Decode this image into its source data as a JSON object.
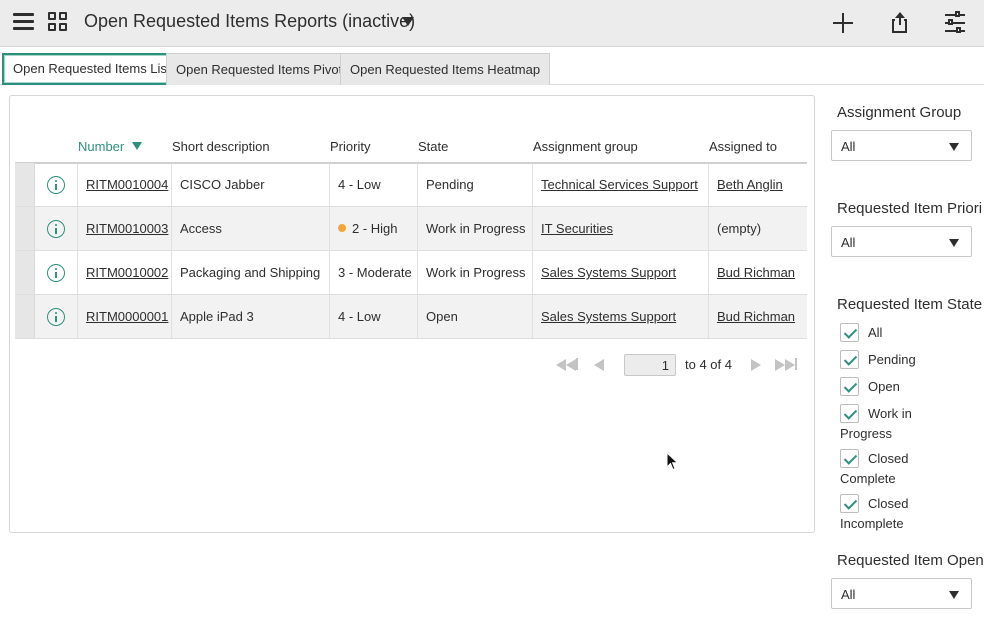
{
  "header": {
    "title": "Open Requested Items Reports (inactive)",
    "icons": [
      "hamburger-menu-icon",
      "grid-icon",
      "chevron-down-icon",
      "plus-icon",
      "share-icon",
      "sliders-icon"
    ]
  },
  "tabs": [
    {
      "label": "Open Requested Items List",
      "active": true
    },
    {
      "label": "Open Requested Items Pivot",
      "active": false
    },
    {
      "label": "Open Requested Items Heatmap",
      "active": false
    }
  ],
  "table": {
    "columns": [
      "Number",
      "Short description",
      "Priority",
      "State",
      "Assignment group",
      "Assigned to"
    ],
    "sorted_column": "Number",
    "rows": [
      {
        "number": "RITM0010004",
        "short_description": "CISCO Jabber",
        "priority": "4 - Low",
        "priority_dot": false,
        "state": "Pending",
        "assignment_group": "Technical Services Support",
        "assigned_to": "Beth Anglin",
        "assigned_link": true
      },
      {
        "number": "RITM0010003",
        "short_description": "Access",
        "priority": "2 - High",
        "priority_dot": true,
        "state": "Work in Progress",
        "assignment_group": "IT Securities",
        "assigned_to": "(empty)",
        "assigned_link": false
      },
      {
        "number": "RITM0010002",
        "short_description": "Packaging and Shipping",
        "priority": "3 - Moderate",
        "priority_dot": false,
        "state": "Work in Progress",
        "assignment_group": "Sales Systems Support",
        "assigned_to": "Bud Richman",
        "assigned_link": true
      },
      {
        "number": "RITM0000001",
        "short_description": "Apple iPad 3",
        "priority": "4 - Low",
        "priority_dot": false,
        "state": "Open",
        "assignment_group": "Sales Systems Support",
        "assigned_to": "Bud Richman",
        "assigned_link": true
      }
    ]
  },
  "pager": {
    "page": "1",
    "of_text": "to 4 of 4"
  },
  "filters": {
    "assignment_group": {
      "title": "Assignment Group",
      "value": "All"
    },
    "priority": {
      "title": "Requested Item Priori",
      "value": "All"
    },
    "state": {
      "title": "Requested Item State",
      "options": [
        {
          "label": "All",
          "checked": true
        },
        {
          "label": "Pending",
          "checked": true
        },
        {
          "label": "Open",
          "checked": true
        },
        {
          "label": "Work in Progress",
          "checked": true
        },
        {
          "label": "Closed Complete",
          "checked": true
        },
        {
          "label": "Closed Incomplete",
          "checked": true
        }
      ]
    },
    "opened": {
      "title": "Requested Item Open",
      "value": "All"
    }
  },
  "colors": {
    "accent": "#2f8f7e",
    "priority_high_dot": "#f4a535",
    "header_bg": "#ececec"
  }
}
